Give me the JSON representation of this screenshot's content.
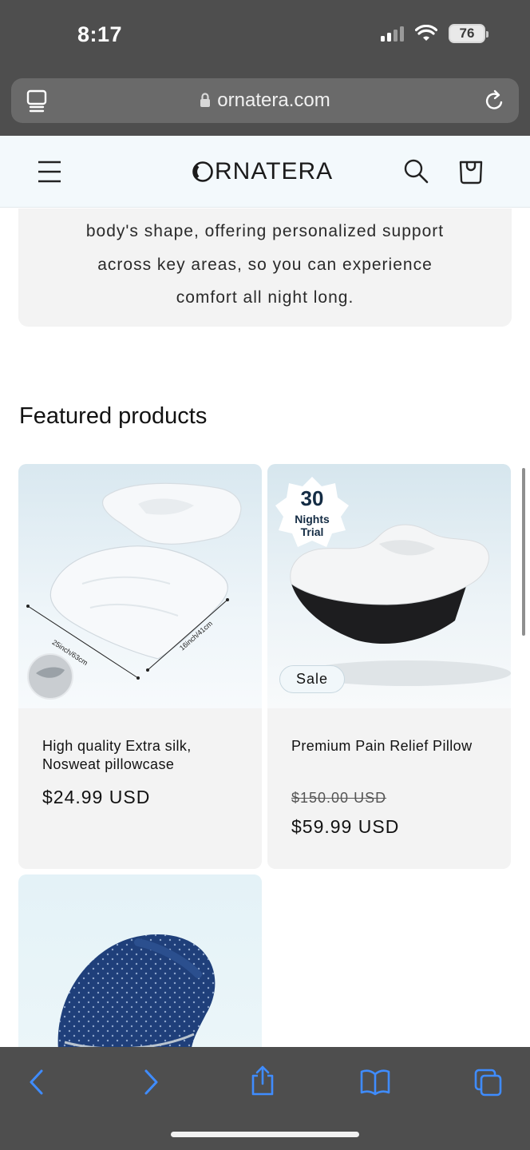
{
  "status_bar": {
    "time": "8:17",
    "battery": "76"
  },
  "browser": {
    "url": "ornatera.com"
  },
  "store": {
    "logo_text": "RNATERA"
  },
  "intro": {
    "lines": [
      "body's shape, offering personalized support",
      "across key areas, so you can experience",
      "comfort all night long."
    ]
  },
  "featured": {
    "title": "Featured products",
    "products": [
      {
        "title": "High quality Extra silk, Nosweat pillowcase",
        "price": "$24.99 USD",
        "dimension_a": "25inch/63cm",
        "dimension_b": "16inch/41cm"
      },
      {
        "title": "Premium Pain Relief Pillow",
        "price_old": "$150.00 USD",
        "price": "$59.99 USD",
        "badge": "Sale",
        "trial_number": "30",
        "trial_line1": "Nights",
        "trial_line2": "Trial"
      }
    ]
  },
  "colors": {
    "chrome": "#4e4e4e",
    "accent_blue": "#3f8cff",
    "card_bg": "#f3f3f3",
    "header_bg": "#f3f9fc"
  }
}
